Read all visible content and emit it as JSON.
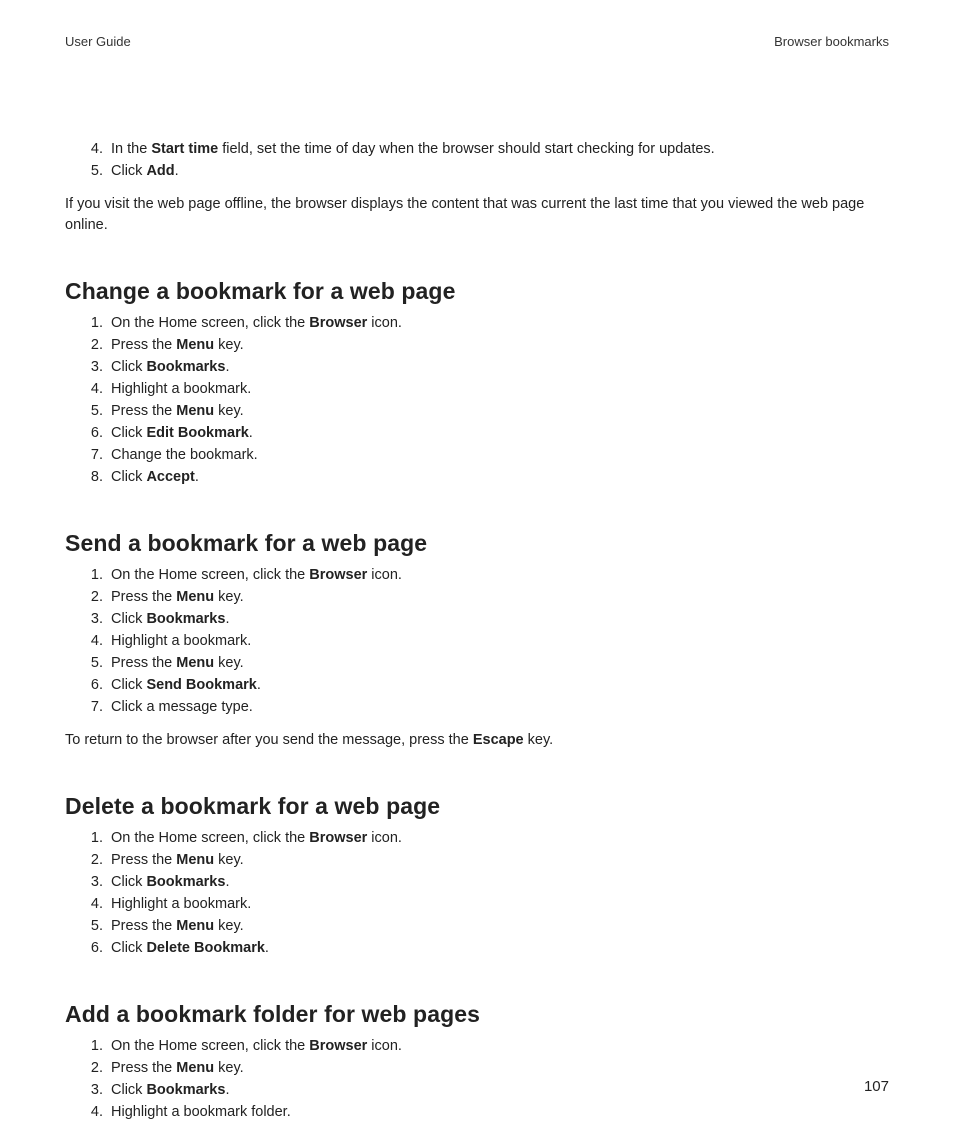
{
  "header": {
    "left": "User Guide",
    "right": "Browser bookmarks"
  },
  "intro_steps": [
    {
      "num": "4",
      "parts": [
        "In the ",
        "Start time",
        " field, set the time of day when the browser should start checking for updates."
      ]
    },
    {
      "num": "5",
      "parts": [
        "Click ",
        "Add",
        "."
      ]
    }
  ],
  "intro_followup": "If you visit the web page offline, the browser displays the content that was current the last time that you viewed the web page online.",
  "sections": [
    {
      "heading": "Change a bookmark for a web page",
      "steps": [
        {
          "parts": [
            "On the Home screen, click the ",
            "Browser",
            " icon."
          ]
        },
        {
          "parts": [
            "Press the ",
            "Menu",
            " key."
          ]
        },
        {
          "parts": [
            "Click ",
            "Bookmarks",
            "."
          ]
        },
        {
          "parts": [
            "Highlight a bookmark."
          ]
        },
        {
          "parts": [
            "Press the ",
            "Menu",
            " key."
          ]
        },
        {
          "parts": [
            "Click ",
            "Edit Bookmark",
            "."
          ]
        },
        {
          "parts": [
            "Change the bookmark."
          ]
        },
        {
          "parts": [
            "Click ",
            "Accept",
            "."
          ]
        }
      ]
    },
    {
      "heading": "Send a bookmark for a web page",
      "steps": [
        {
          "parts": [
            "On the Home screen, click the ",
            "Browser",
            " icon."
          ]
        },
        {
          "parts": [
            "Press the ",
            "Menu",
            " key."
          ]
        },
        {
          "parts": [
            "Click ",
            "Bookmarks",
            "."
          ]
        },
        {
          "parts": [
            "Highlight a bookmark."
          ]
        },
        {
          "parts": [
            "Press the ",
            "Menu",
            " key."
          ]
        },
        {
          "parts": [
            "Click ",
            "Send Bookmark",
            "."
          ]
        },
        {
          "parts": [
            "Click a message type."
          ]
        }
      ],
      "after": {
        "parts": [
          "To return to the browser after you send the message, press the ",
          "Escape",
          " key."
        ]
      }
    },
    {
      "heading": "Delete a bookmark for a web page",
      "steps": [
        {
          "parts": [
            "On the Home screen, click the ",
            "Browser",
            " icon."
          ]
        },
        {
          "parts": [
            "Press the ",
            "Menu",
            " key."
          ]
        },
        {
          "parts": [
            "Click ",
            "Bookmarks",
            "."
          ]
        },
        {
          "parts": [
            "Highlight a bookmark."
          ]
        },
        {
          "parts": [
            "Press the ",
            "Menu",
            " key."
          ]
        },
        {
          "parts": [
            "Click ",
            "Delete Bookmark",
            "."
          ]
        }
      ]
    },
    {
      "heading": "Add a bookmark folder for web pages",
      "steps": [
        {
          "parts": [
            "On the Home screen, click the ",
            "Browser",
            " icon."
          ]
        },
        {
          "parts": [
            "Press the ",
            "Menu",
            " key."
          ]
        },
        {
          "parts": [
            "Click ",
            "Bookmarks",
            "."
          ]
        },
        {
          "parts": [
            "Highlight a bookmark folder."
          ]
        }
      ]
    }
  ],
  "page_number": "107"
}
